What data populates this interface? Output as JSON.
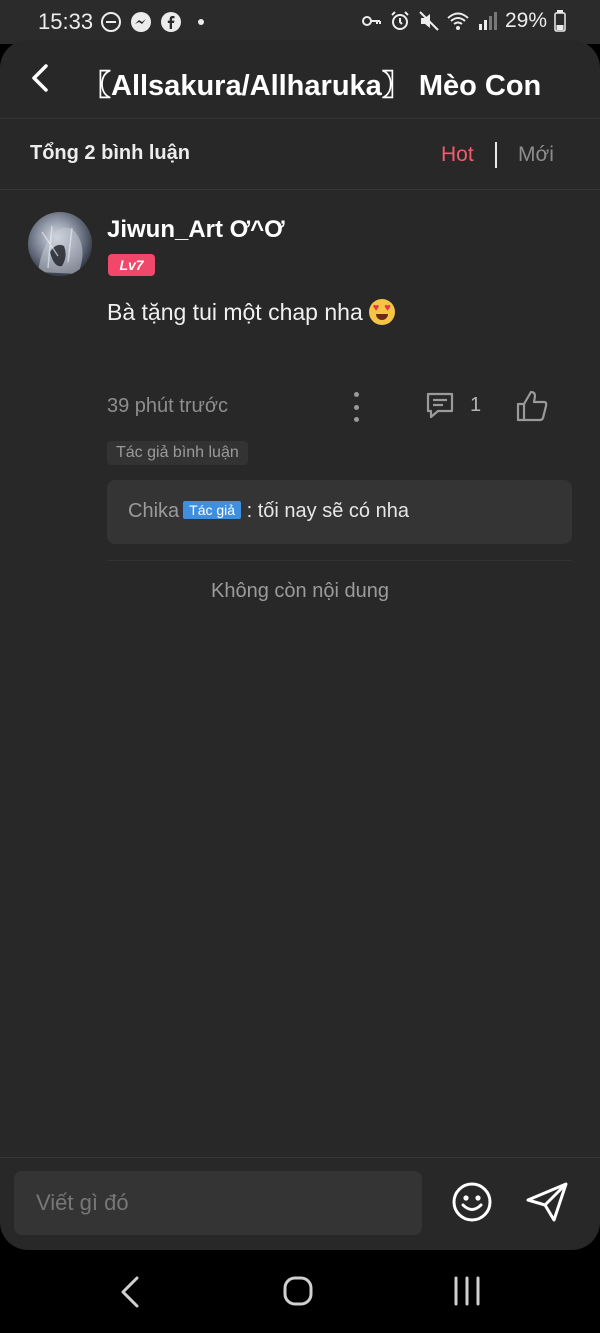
{
  "status_bar": {
    "time": "15:33",
    "battery": "29%"
  },
  "header": {
    "title": "〖Allsakura/Allharuka〗 Mèo Con"
  },
  "summary": {
    "total": "Tổng 2 bình luận",
    "sort_hot": "Hot",
    "sort_new": "Mới"
  },
  "comment": {
    "username": "Jiwun_Art Ơ^Ơ",
    "level": "Lv7",
    "text": "Bà tặng tui một chap nha",
    "time": "39 phút trước",
    "reply_count": "1",
    "author_tag": "Tác giả bình luận",
    "reply": {
      "name": "Chika",
      "badge": "Tác giả",
      "text": ": tối nay sẽ có nha"
    }
  },
  "end_text": "Không còn nội dung",
  "input": {
    "placeholder": "Viết gì đó"
  },
  "colors": {
    "accent": "#f25c6c",
    "level_badge": "#f0486a",
    "author_badge": "#3f8fe0",
    "background": "#282828"
  },
  "icons": [
    "back-arrow-icon",
    "more-dots-icon",
    "comment-icon",
    "thumbs-up-icon",
    "emoji-smile-icon",
    "send-icon",
    "nav-back-icon",
    "nav-home-icon",
    "nav-recent-icon"
  ]
}
